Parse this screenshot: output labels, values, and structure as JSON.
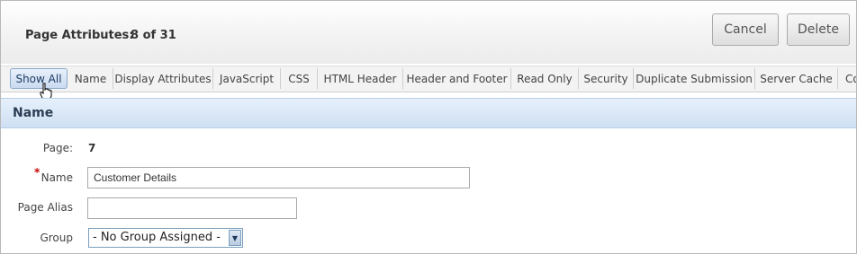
{
  "header": {
    "title": "Page Attributes:",
    "count": "8 of 31",
    "cancel_label": "Cancel",
    "delete_label": "Delete"
  },
  "tabs": [
    {
      "label": "Show All"
    },
    {
      "label": "Name"
    },
    {
      "label": "Display Attributes"
    },
    {
      "label": "JavaScript"
    },
    {
      "label": "CSS"
    },
    {
      "label": "HTML Header"
    },
    {
      "label": "Header and Footer"
    },
    {
      "label": "Read Only"
    },
    {
      "label": "Security"
    },
    {
      "label": "Duplicate Submission"
    },
    {
      "label": "Server Cache"
    },
    {
      "label": "Co"
    }
  ],
  "section": {
    "title": "Name"
  },
  "form": {
    "page_label": "Page:",
    "page_value": "7",
    "required_marker": "*",
    "name_label": "Name",
    "name_value": "Customer Details",
    "alias_label": "Page Alias",
    "alias_value": "",
    "group_label": "Group",
    "group_value": "- No Group Assigned -"
  }
}
